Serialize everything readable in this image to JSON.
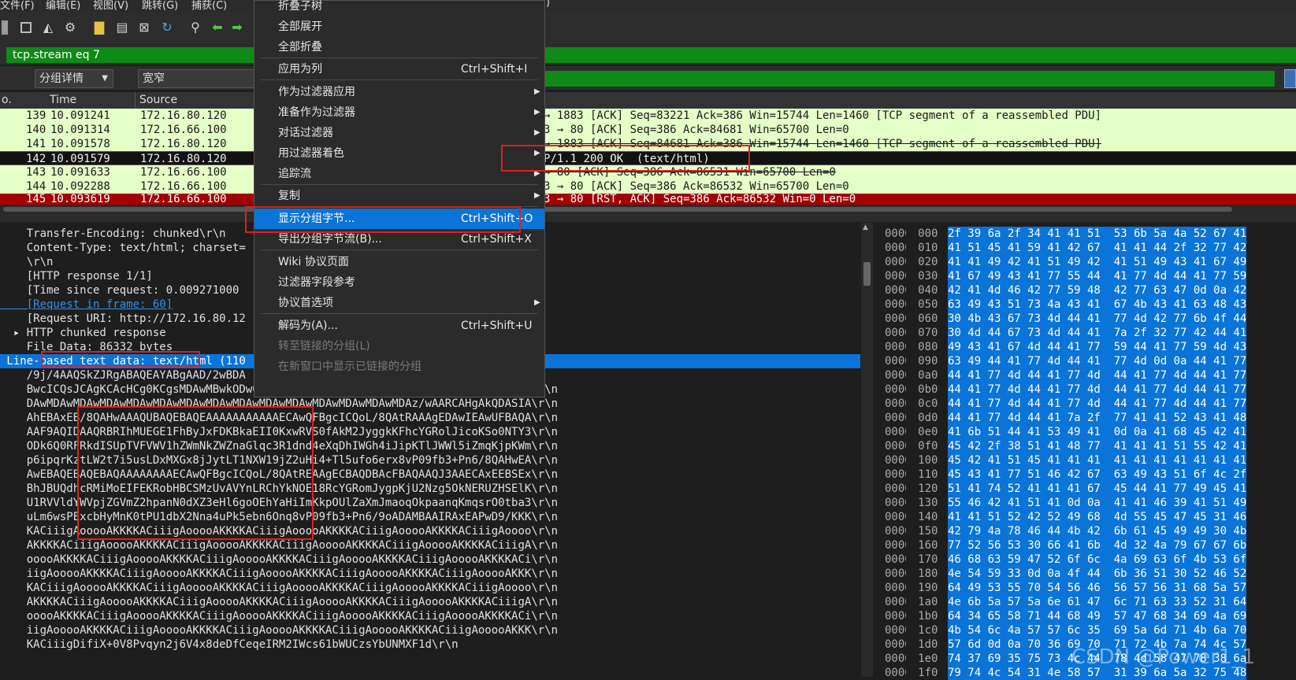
{
  "menubar": {
    "items": [
      "文件(F)",
      "编辑(E)",
      "视图(V)",
      "跳转(G)",
      "捕获(C)",
      ")"
    ]
  },
  "filter": {
    "value": "tcp.stream eq 7"
  },
  "bar2": {
    "combo1": "分组详情",
    "combo2": "宽窄"
  },
  "packet_list": {
    "headers": [
      "o.",
      "Time",
      "Source"
    ],
    "rows": [
      {
        "no": "139",
        "time": "10.091241",
        "src": "172.16.80.120",
        "info": "→ 1883 [ACK] Seq=83221 Ack=386 Win=15744 Len=1460 [TCP segment of a reassembled PDU]"
      },
      {
        "no": "140",
        "time": "10.091314",
        "src": "172.16.66.100",
        "info": "3 → 80 [ACK] Seq=386 Ack=84681 Win=65700 Len=0"
      },
      {
        "no": "141",
        "time": "10.091578",
        "src": "172.16.80.120",
        "info": "→ 1883 [ACK] Seq=84681 Ack=386 Win=15744 Len=1460 [TCP segment of a reassembled PDU]"
      },
      {
        "no": "142",
        "time": "10.091579",
        "src": "172.16.80.120",
        "info": "P/1.1 200 OK  (text/html)"
      },
      {
        "no": "143",
        "time": "10.091633",
        "src": "172.16.66.100",
        "info": "→ 80 [ACK] Seq=386 Ack=86531 Win=65700 Len=0"
      },
      {
        "no": "144",
        "time": "10.092288",
        "src": "172.16.66.100",
        "info": "3 → 80 [ACK] Seq=386 Ack=86532 Win=65700 Len=0"
      },
      {
        "no": "145",
        "time": "10.093619",
        "src": "172.16.66.100",
        "info": "3 → 80 [RST, ACK] Seq=386 Ack=86532 Win=0 Len=0"
      }
    ]
  },
  "details": {
    "lines": [
      "    Transfer-Encoding: chunked\\r\\n",
      "    Content-Type: text/html; charset=",
      "    \\r\\n",
      "    [HTTP response 1/1]",
      "    [Time since request: 0.009271000",
      "    [Request in frame: 60]",
      "    [Request URI: http://172.16.80.12",
      "  ▸ HTTP chunked response",
      "    File Data: 86332 bytes",
      " Line-based text data: text/html (110",
      "    /9j/4AAQSkZJRgABAQEAYABgAAD/2wBDA                                       \\r\\n",
      "    BwcICQsJCAgKCAcHCg0KCgsMDAwMBwkODw0MDgsMDAz/2wBDAQICAgMDAwYDAwYMCAcIDAwMDAwM\\r\\n",
      "    DAwMDAwMDAwMDAwMDAwMDAwMDAwMDAwMDAwMDAwMDAwMDAwMDAwMDAwMDAz/wAARCAHgAkQDASIA\\r\\n",
      "    AhEBAxEB/8QAHwAAAQUBAQEBAQEAAAAAAAAAAAECAwQFBgcICQoL/8QAtRAAAgEDAwIEAwUFBAQA\\r\\n",
      "    AAF9AQIDAAQRBRIhMUEGE1FhByJxFDKBkaEII0KxwRVS0fAkM2JyggkKFhcYGRolJicoKSo0NTY3\\r\\n",
      "    ODk6Q0RFRkdISUpTVFVWV1hZWmNkZWZnaGlqc3R1dnd4eXqDhIWGh4iJipKTlJWWl5iZmqKjpKWm\\r\\n",
      "    p6ipqrKztLW2t7i5usLDxMXGx8jJytLT1NXW19jZ2uHi4+Tl5ufo6erx8vP09fb3+Pn6/8QAHwEA\\r\\n",
      "    AwEBAQEBAQEBAQAAAAAAAAECAwQFBgcICQoL/8QAtREAAgECBAQDBAcFBAQAAQJ3AAECAxEEBSEx\\r\\n",
      "    BhJBUQdhcRMiMoEIFEKRobHBCSMzUvAVYnLRChYkNOE18RcYGRomJygpKjU2Nzg5OkNERUZHSElK\\r\\n",
      "    U1RVVldYWVpjZGVmZ2hpanN0dXZ3eHl6goOEhYaHiImKkpOUlZaXmJmaoqOkpaanqKmqsrO0tba3\\r\\n",
      "    uLm6wsPExcbHyMnK0tPU1dbX2Nna4uPk5ebn6Onq8vP09fb3+Pn6/9oADAMBAAIRAxEAPwD9/KKK\\r\\n",
      "    KACiiigAooooAKKKKACiiigAooooAKKKKACiiigAooooAKKKKACiiigAooooAKKKKACiiigAoooo\\r\\n",
      "    AKKKKACiiigAooooAKKKKACiiigAooooAKKKKACiiigAooooAKKKKACiiigAooooAKKKKACiiigA\\r\\n",
      "    ooooAKKKKACiiigAooooAKKKKACiiigAooooAKKKKACiiigAooooAKKKKACiiigAooooAKKKKACi\\r\\n",
      "    iigAooooAKKKKACiiigAooooAKKKKACiiigAooooAKKKKACiiigAooooAKKKKACiiigAooooAKKK\\r\\n",
      "    KACiiigAooooAKKKKACiiigAooooAKKKKACiiigAooooAKKKKACiiigAooooAKKKKACiiigAoooo\\r\\n",
      "    AKKKKACiiigAooooAKKKKACiiigAooooAKKKKACiiigAooooAKKKKACiiigAooooAKKKKACiiigA\\r\\n",
      "    ooooAKKKKACiiigAooooAKKKKACiiigAooooAKKKKACiiigAooooAKKKKACiiigAooooAKKKKACi\\r\\n",
      "    iigAooooAKKKKACiiigAooooAKKKKACiiigAooooAKKKKACiiigAooooAKKKKACiiigAooooAKKK\\r\\n",
      "    KACiiigDifiX+0V8Pvqyn2j6V4x8deDfCeqeIRM2IWcs61bWUCzsYbUNMXF1d\\r\\n"
    ]
  },
  "hex": {
    "offsets": [
      "00000000",
      "00000010",
      "00000020",
      "00000030",
      "00000040",
      "00000050",
      "00000060",
      "00000070",
      "00000080",
      "00000090",
      "000000a0",
      "000000b0",
      "000000c0",
      "000000d0",
      "000000e0",
      "000000f0",
      "00000100",
      "00000110",
      "00000120",
      "00000130",
      "00000140",
      "00000150",
      "00000160",
      "00000170",
      "00000180",
      "00000190",
      "000001a0",
      "000001b0",
      "000001c0",
      "000001d0",
      "000001e0",
      "000001f0"
    ],
    "bytes": [
      "2f 39 6a 2f 34 41 41 51  53 6b 5a 4a 52 67 41",
      "41 51 45 41 59 41 42 67  41 41 44 2f 32 77 42",
      "41 41 49 42 41 51 49 42  41 51 49 43 41 67 49",
      "41 67 49 43 41 77 55 44  41 77 4d 44 41 77 59",
      "42 41 4d 46 42 77 59 48  42 77 63 47 0d 0a 42",
      "63 49 43 51 73 4a 43 41  67 4b 43 41 63 48 43",
      "30 4b 43 67 73 4d 44 41  77 4d 42 77 6b 4f 44",
      "30 4d 44 67 73 4d 44 41  7a 2f 32 77 42 44 41",
      "49 43 41 67 4d 44 41 77  59 44 41 77 59 4d 43",
      "63 49 44 41 77 4d 44 41  77 4d 0d 0a 44 41 77",
      "44 41 77 4d 44 41 77 4d  44 41 77 4d 44 41 77",
      "44 41 77 4d 44 41 77 4d  44 41 77 4d 44 41 77",
      "44 41 77 4d 44 41 77 4d  44 41 77 4d 44 41 77",
      "44 41 77 4d 44 41 7a 2f  77 41 41 52 43 41 48",
      "41 6b 51 44 41 53 49 41  0d 0a 41 68 45 42 41",
      "45 42 2f 38 51 41 48 77  41 41 41 51 55 42 41",
      "45 42 41 51 45 41 41 41  41 41 41 41 41 41 41",
      "45 43 41 77 51 46 42 67  63 49 43 51 6f 4c 2f",
      "51 41 74 52 41 41 41 67  45 44 41 77 49 45 41",
      "55 46 42 41 51 41 0d 0a  41 41 46 39 41 51 49",
      "41 41 51 52 42 52 49 68  4d 55 45 47 45 31 46",
      "42 79 4a 78 46 44 4b 42  6b 61 45 49 49 30 4b",
      "77 52 56 53 30 66 41 6b  4d 32 4a 79 67 67 6b",
      "46 68 63 59 47 52 6f 6c  4a 69 63 6f 4b 53 6f",
      "4e 54 59 33 0d 0a 4f 44  6b 36 51 30 52 46 52",
      "64 49 53 55 70 54 56 46  56 57 56 31 68 5a 57",
      "4e 6b 5a 57 5a 6e 61 47  6c 71 63 33 52 31 64",
      "64 34 65 58 71 44 68 49  57 47 68 34 69 4a 69",
      "4b 54 6c 4a 57 57 6c 35  69 5a 6d 71 4b 6a 70",
      "57 6d 0d 0a 70 36 69 70  71 72 4b 7a 74 4c 57",
      "74 37 69 35 75 73 4c 44  78 4d 58 47 78 38 6a",
      "79 74 4c 54 31 4e 58 57  31 39 6a 5a 32 75 48"
    ]
  },
  "context_menu": {
    "items": [
      {
        "label": "折叠子树",
        "shortcut": "",
        "arrow": false,
        "disabled": false
      },
      {
        "label": "全部展开",
        "shortcut": "",
        "arrow": false,
        "disabled": false
      },
      {
        "label": "全部折叠",
        "shortcut": "",
        "arrow": false,
        "disabled": false
      },
      {
        "label": "应用为列",
        "shortcut": "Ctrl+Shift+I",
        "arrow": false,
        "disabled": false
      },
      {
        "label": "作为过滤器应用",
        "shortcut": "",
        "arrow": true,
        "disabled": false
      },
      {
        "label": "准备作为过滤器",
        "shortcut": "",
        "arrow": true,
        "disabled": false
      },
      {
        "label": "对话过滤器",
        "shortcut": "",
        "arrow": true,
        "disabled": false
      },
      {
        "label": "用过滤器着色",
        "shortcut": "",
        "arrow": true,
        "disabled": false
      },
      {
        "label": "追踪流",
        "shortcut": "",
        "arrow": true,
        "disabled": false
      },
      {
        "label": "复制",
        "shortcut": "",
        "arrow": true,
        "disabled": false
      },
      {
        "label": "显示分组字节...",
        "shortcut": "Ctrl+Shift+O",
        "arrow": false,
        "disabled": false
      },
      {
        "label": "导出分组字节流(B)...",
        "shortcut": "Ctrl+Shift+X",
        "arrow": false,
        "disabled": false
      },
      {
        "label": "Wiki 协议页面",
        "shortcut": "",
        "arrow": false,
        "disabled": false
      },
      {
        "label": "过滤器字段参考",
        "shortcut": "",
        "arrow": false,
        "disabled": false
      },
      {
        "label": "协议首选项",
        "shortcut": "",
        "arrow": true,
        "disabled": false
      },
      {
        "label": "解码为(A)...",
        "shortcut": "Ctrl+Shift+U",
        "arrow": false,
        "disabled": false
      },
      {
        "label": "转至链接的分组(L)",
        "shortcut": "",
        "arrow": false,
        "disabled": true
      },
      {
        "label": "在新窗口中显示已链接的分组",
        "shortcut": "",
        "arrow": false,
        "disabled": true
      }
    ]
  },
  "watermark": "CSDN @Power1_1",
  "colors": {
    "green": "#0e8a16",
    "selected": "#0a74d8",
    "row_light": "#e4ffc7",
    "row_dark": "#121212",
    "row_rst": "#a40000",
    "red_box": "#e02020"
  }
}
